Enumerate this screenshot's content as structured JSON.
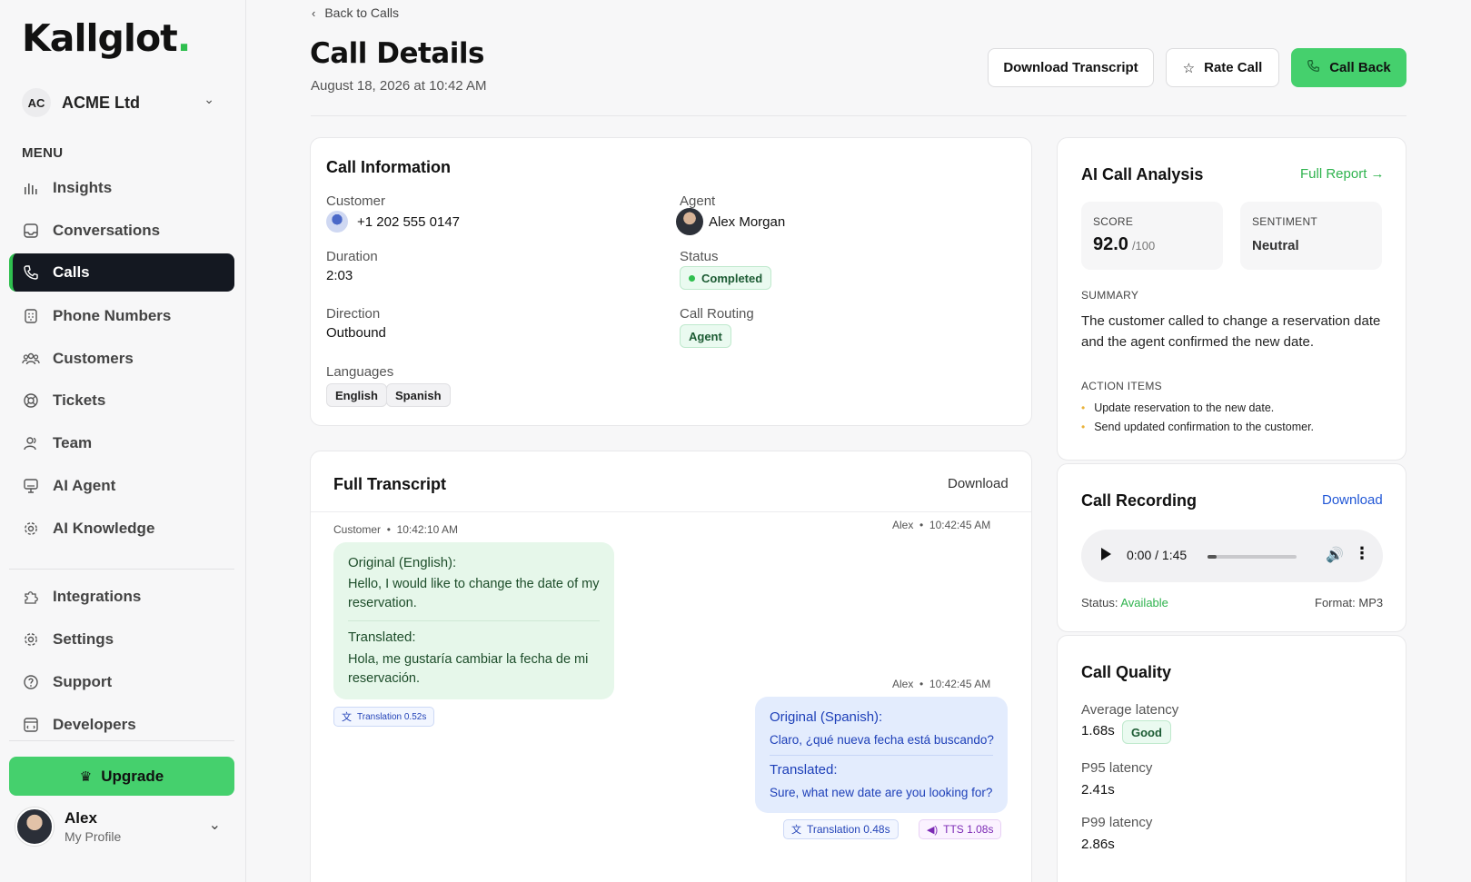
{
  "app": {
    "logo": "Kallglot",
    "logo_dot": "."
  },
  "org": {
    "initials": "AC",
    "name": "ACME Ltd"
  },
  "sidebar": {
    "menu_title": "MENU",
    "items": [
      {
        "label": "Insights",
        "icon": "bar-chart-icon"
      },
      {
        "label": "Conversations",
        "icon": "inbox-icon"
      },
      {
        "label": "Calls",
        "icon": "phone-icon",
        "active": true
      },
      {
        "label": "Phone Numbers",
        "icon": "dialpad-icon"
      },
      {
        "label": "Customers",
        "icon": "users-icon"
      },
      {
        "label": "Tickets",
        "icon": "ticket-icon"
      },
      {
        "label": "Team",
        "icon": "team-icon"
      },
      {
        "label": "AI Agent",
        "icon": "monitor-icon"
      },
      {
        "label": "AI Knowledge",
        "icon": "gear-icon"
      }
    ],
    "secondary_items": [
      {
        "label": "Integrations",
        "icon": "puzzle-icon"
      },
      {
        "label": "Settings",
        "icon": "settings-icon"
      },
      {
        "label": "Support",
        "icon": "help-icon"
      },
      {
        "label": "Developers",
        "icon": "code-icon"
      }
    ],
    "upgrade_label": "Upgrade",
    "profile": {
      "name": "Alex",
      "sub": "My Profile"
    }
  },
  "header": {
    "back_label": "Back to Calls",
    "title": "Call Details",
    "subtitle": "August 18, 2026 at 10:42 AM",
    "buttons": {
      "download": "Download Transcript",
      "rate": "Rate Call",
      "call_back": "Call Back"
    }
  },
  "call_info": {
    "title": "Call Information",
    "customer_label": "Customer",
    "customer_value": "+1 202 555 0147",
    "agent_label": "Agent",
    "agent_value": "Alex Morgan",
    "duration_label": "Duration",
    "duration_value": "2:03",
    "status_label": "Status",
    "status_value": "Completed",
    "direction_label": "Direction",
    "direction_value": "Outbound",
    "routing_label": "Call Routing",
    "routing_value": "Agent",
    "languages_label": "Languages",
    "languages": [
      "English",
      "Spanish"
    ]
  },
  "transcript": {
    "title": "Full Transcript",
    "download_label": "Download",
    "messages": [
      {
        "speaker": "Customer",
        "sep": "•",
        "time": "10:42:10 AM",
        "original_label": "Original (English):",
        "original_text": "Hello, I would like to change the date of my reservation.",
        "translated_label": "Translated:",
        "translated_text": "Hola, me gustaría cambiar la fecha de mi reservación.",
        "tags": [
          "Translation 0.52s"
        ]
      },
      {
        "speaker": "Alex",
        "sep": "•",
        "time": "10:42:45 AM",
        "original_label": "Original (Spanish):",
        "original_text": "Claro, ¿qué nueva fecha está buscando?",
        "translated_label": "Translated:",
        "translated_text": "Sure, what new date are you looking for?",
        "tags": [
          "Translation 0.48s",
          "TTS 1.08s"
        ]
      }
    ],
    "top_right_meta": {
      "speaker": "Alex",
      "sep": "•",
      "time": "10:42:45 AM"
    }
  },
  "analysis": {
    "title": "AI Call Analysis",
    "full_report": "Full Report →",
    "score_label": "SCORE",
    "score_value": "92.0",
    "score_unit": "/100",
    "sentiment_label": "SENTIMENT",
    "sentiment_value": "Neutral",
    "summary_label": "SUMMARY",
    "summary_text": "The customer called to change a reservation date and the agent confirmed the new date.",
    "actions_label": "ACTION ITEMS",
    "actions": [
      "Update reservation to the new date.",
      "Send updated confirmation to the customer."
    ]
  },
  "recording": {
    "title": "Call Recording",
    "download_label": "Download",
    "time": "0:00 / 1:45",
    "progress": 0.1,
    "status_label": "Status:",
    "status_value": "Available",
    "format_label": "Format: MP3"
  },
  "quality": {
    "title": "Call Quality",
    "avg_label": "Average latency",
    "avg_value": "1.68s",
    "avg_badge": "Good",
    "p95_label": "P95 latency",
    "p95_value": "2.41s",
    "p99_label": "P99 latency",
    "p99_value": "2.86s"
  },
  "colors": {
    "accent_green": "#45d06d",
    "active_nav": "#141821",
    "link_blue": "#2157d6"
  }
}
